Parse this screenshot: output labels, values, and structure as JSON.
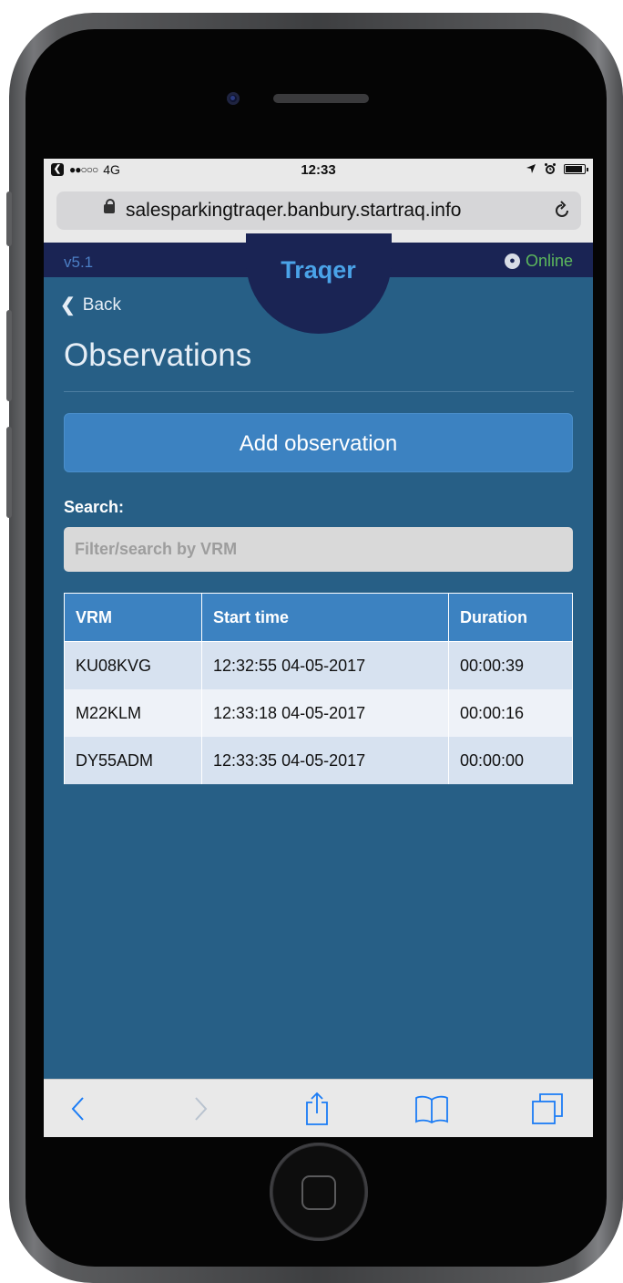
{
  "status_bar": {
    "signal": "●●○○○",
    "network": "4G",
    "time": "12:33"
  },
  "browser": {
    "url": "salesparkingtraqer.banbury.startraq.info"
  },
  "header": {
    "version": "v5.1",
    "brand": "Traqer",
    "status": "Online"
  },
  "nav": {
    "back_label": "Back"
  },
  "page": {
    "title": "Observations",
    "add_button": "Add observation",
    "search_label": "Search:",
    "search_placeholder": "Filter/search by VRM"
  },
  "table": {
    "columns": [
      "VRM",
      "Start time",
      "Duration"
    ],
    "rows": [
      {
        "vrm": "KU08KVG",
        "start": "12:32:55 04-05-2017",
        "duration": "00:00:39"
      },
      {
        "vrm": "M22KLM",
        "start": "12:33:18 04-05-2017",
        "duration": "00:00:16"
      },
      {
        "vrm": "DY55ADM",
        "start": "12:33:35 04-05-2017",
        "duration": "00:00:00"
      }
    ]
  },
  "toolbar": {
    "icons": [
      "back-arrow-icon",
      "forward-arrow-icon",
      "share-icon",
      "bookmarks-icon",
      "tabs-icon"
    ]
  },
  "colors": {
    "screen_bg": "#275f86",
    "header_bg": "#1a2454",
    "brand": "#4aa3e8",
    "accent_button": "#3c82c1",
    "online": "#5cb85c"
  }
}
